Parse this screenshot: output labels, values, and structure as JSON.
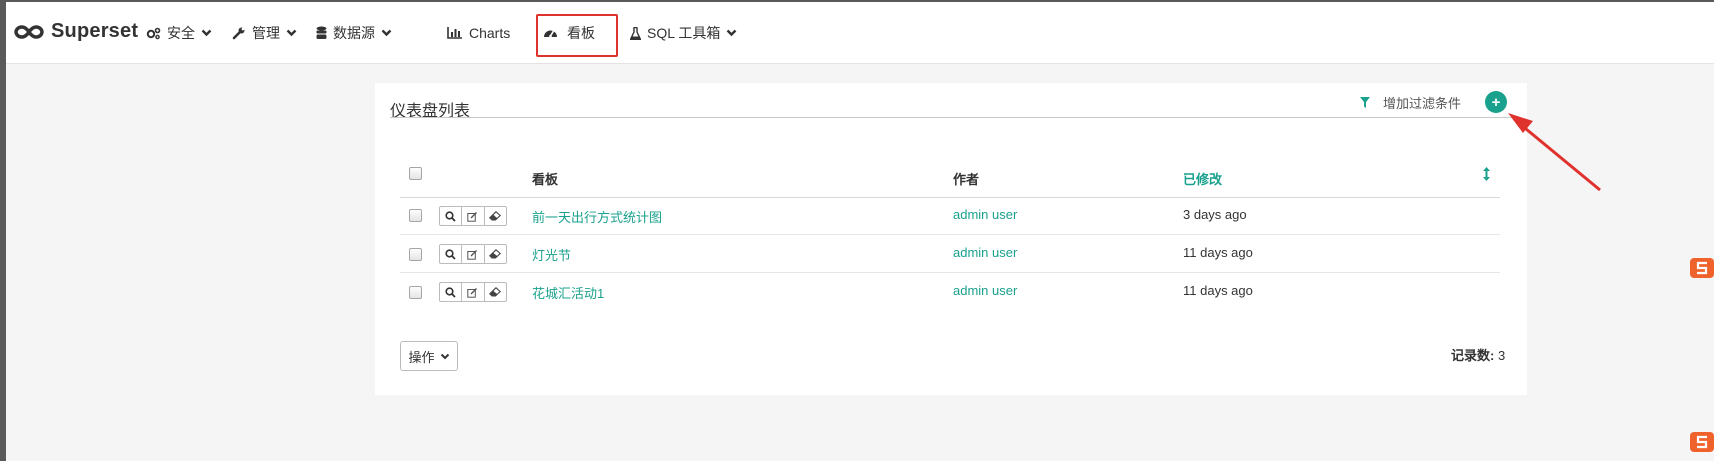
{
  "navbar": {
    "brand": "Superset",
    "items": [
      {
        "label": "安全",
        "icon": "gears-icon",
        "dropdown": true
      },
      {
        "label": "管理",
        "icon": "wrench-icon",
        "dropdown": true
      },
      {
        "label": "数据源",
        "icon": "database-icon",
        "dropdown": true
      },
      {
        "label": "Charts",
        "icon": "bar-chart-icon",
        "dropdown": false
      },
      {
        "label": "看板",
        "icon": "dashboard-icon",
        "dropdown": false,
        "active": true
      },
      {
        "label": "SQL 工具箱",
        "icon": "flask-icon",
        "dropdown": true
      }
    ]
  },
  "panel": {
    "title": "仪表盘列表",
    "filter_label": "增加过滤条件",
    "add_label": "+"
  },
  "table": {
    "columns": [
      "看板",
      "作者",
      "已修改"
    ],
    "sorted_column": "已修改",
    "rows": [
      {
        "name": "前一天出行方式统计图",
        "author": "admin user",
        "modified": "3 days ago"
      },
      {
        "name": "灯光节",
        "author": "admin user",
        "modified": "11 days ago"
      },
      {
        "name": "花城汇活动1",
        "author": "admin user",
        "modified": "11 days ago"
      }
    ],
    "row_actions": [
      "search-icon",
      "edit-icon",
      "eraser-icon"
    ]
  },
  "footer": {
    "actions_label": "操作",
    "record_label": "记录数:",
    "record_count": "3"
  },
  "colors": {
    "accent": "#1aa18d",
    "highlight": "#e0322d",
    "background": "#f5f5f5"
  }
}
